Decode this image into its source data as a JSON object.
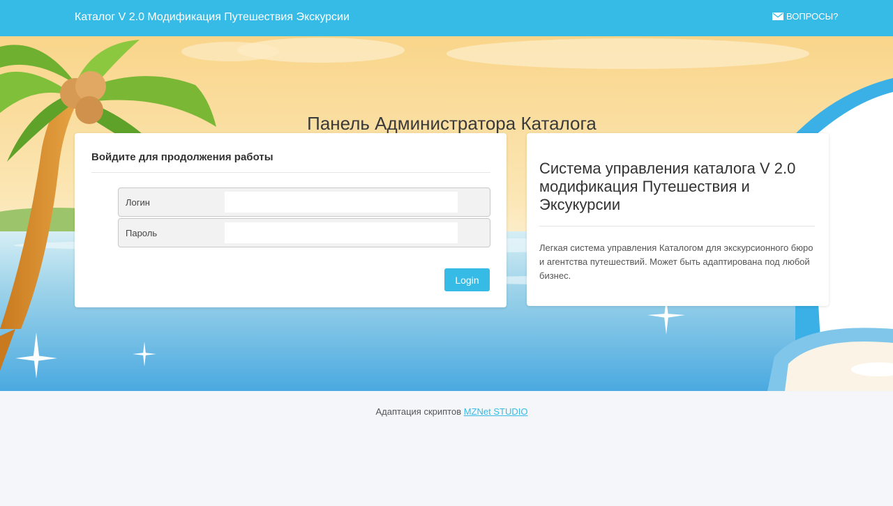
{
  "topbar": {
    "brand": "Каталог V 2.0 Модификация Путешествия Экскурсии",
    "questions_label": "ВОПРОСЫ?",
    "questions_icon": "mail-icon",
    "background_color": "#35bbe6"
  },
  "hero": {
    "title": "Панель Администратора Каталога"
  },
  "login_form": {
    "heading": "Войдите для продолжения работы",
    "login_label": "Логин",
    "login_value": "",
    "password_label": "Пароль",
    "password_value": "",
    "submit_label": "Login",
    "accent_color": "#35bbe6"
  },
  "info": {
    "title": "Система управления каталога V 2.0 модификация Путешествия и Эксукурсии",
    "text": "Легкая система управления Каталогом для экскурсионного бюро и агентства путешествий. Может быть адаптирована под любой бизнес."
  },
  "footer": {
    "text": "Адаптация скриптов",
    "link_label": "MZNet STUDIO"
  }
}
